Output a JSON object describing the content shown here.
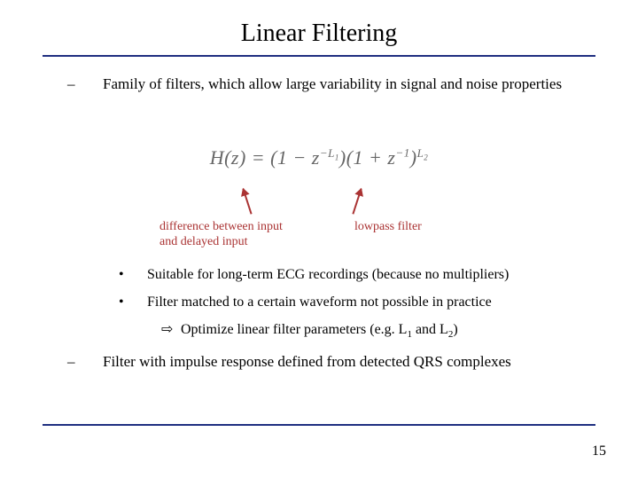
{
  "title": "Linear Filtering",
  "bullets": {
    "b1": "Family of filters, which allow large variability in signal and noise properties",
    "b2": "Filter with impulse response defined from detected QRS complexes"
  },
  "formula": {
    "lhs": "H(z) = (1 − z",
    "exp1_pre": "−L",
    "exp1_sub": "1",
    "mid": ")(1 + z",
    "exp2": "−1",
    "rhs": ")",
    "exp3_pre": "L",
    "exp3_sub": "2"
  },
  "annotation_left_line1": "difference between input",
  "annotation_left_line2": "and delayed input",
  "annotation_right": "lowpass filter",
  "sub_bullets": {
    "s1": "Suitable for long-term ECG recordings (because no multipliers)",
    "s2": "Filter matched to a certain waveform not possible in practice",
    "s3_pre": "Optimize linear filter parameters (e.g. L",
    "s3_sub1": "1",
    "s3_mid": " and L",
    "s3_sub2": "2",
    "s3_end": ")"
  },
  "markers": {
    "dash": "–",
    "dot": "•",
    "arrow": "⇨"
  },
  "page_number": "15"
}
